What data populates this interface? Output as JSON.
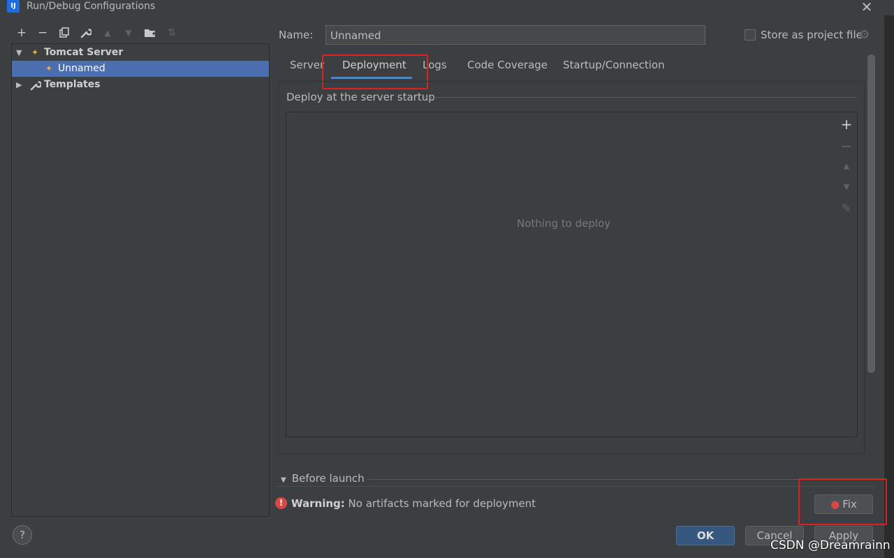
{
  "window": {
    "title": "Run/Debug Configurations",
    "app_icon": "intellij-icon"
  },
  "toolbar": {
    "add": "+",
    "remove": "−",
    "copy": "⧉",
    "edit": "🔧",
    "up": "▲",
    "down": "▼",
    "folder": "📁",
    "sort": "⇅"
  },
  "tree": {
    "items": [
      {
        "label": "Tomcat Server",
        "expanded": true
      },
      {
        "label": "Unnamed",
        "selected": true
      },
      {
        "label": "Templates",
        "expanded": false
      }
    ]
  },
  "form": {
    "name_label": "Name:",
    "name_value": "Unnamed",
    "store_label": "Store as project file",
    "store_checked": false
  },
  "tabs": [
    {
      "label": "Server"
    },
    {
      "label": "Deployment",
      "active": true
    },
    {
      "label": "Logs"
    },
    {
      "label": "Code Coverage"
    },
    {
      "label": "Startup/Connection"
    }
  ],
  "deployment": {
    "section_title": "Deploy at the server startup",
    "empty_text": "Nothing to deploy"
  },
  "before_launch": {
    "label": "Before launch"
  },
  "warning": {
    "bold": "Warning:",
    "message": "No artifacts marked for deployment"
  },
  "buttons": {
    "fix": "Fix",
    "ok": "OK",
    "cancel": "Cancel",
    "apply": "Apply"
  },
  "help": {
    "label": "?"
  },
  "watermark": "CSDN @Dreamrainn",
  "colors": {
    "background": "#3c3f41",
    "selection": "#4b6eaf",
    "accent": "#4a88c7",
    "ok_button": "#365880",
    "highlight_box": "#e01f1f",
    "warning": "#d64745"
  }
}
